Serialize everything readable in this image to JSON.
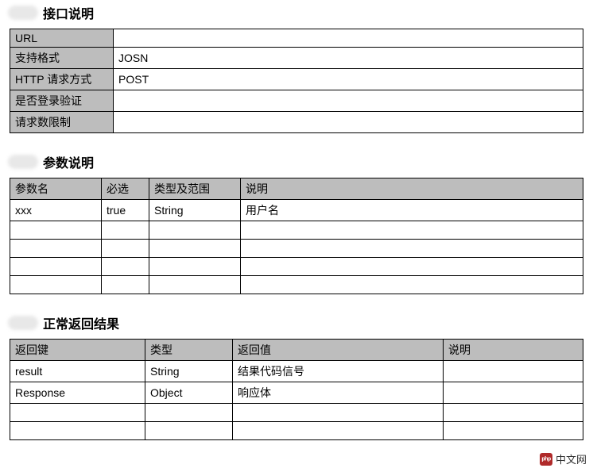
{
  "sections": {
    "api": {
      "title": "接口说明",
      "rows": [
        {
          "key": "URL",
          "value": ""
        },
        {
          "key": "支持格式",
          "value": "JOSN"
        },
        {
          "key": "HTTP 请求方式",
          "value": "POST"
        },
        {
          "key": "是否登录验证",
          "value": ""
        },
        {
          "key": "请求数限制",
          "value": ""
        }
      ]
    },
    "params": {
      "title": "参数说明",
      "headers": [
        "参数名",
        "必选",
        "类型及范围",
        "说明"
      ],
      "rows": [
        {
          "name": "xxx",
          "required": "true",
          "type": "String",
          "desc": "用户名"
        },
        {
          "name": "",
          "required": "",
          "type": "",
          "desc": ""
        },
        {
          "name": "",
          "required": "",
          "type": "",
          "desc": ""
        },
        {
          "name": "",
          "required": "",
          "type": "",
          "desc": ""
        },
        {
          "name": "",
          "required": "",
          "type": "",
          "desc": ""
        }
      ]
    },
    "returns": {
      "title": "正常返回结果",
      "headers": [
        "返回键",
        "类型",
        "返回值",
        "说明"
      ],
      "rows": [
        {
          "key": "result",
          "type": "String",
          "value": "结果代码信号",
          "desc": ""
        },
        {
          "key": "Response",
          "type": "Object",
          "value": "响应体",
          "desc": ""
        },
        {
          "key": "",
          "type": "",
          "value": "",
          "desc": ""
        },
        {
          "key": "",
          "type": "",
          "value": "",
          "desc": ""
        }
      ]
    }
  },
  "watermark": "中文网"
}
